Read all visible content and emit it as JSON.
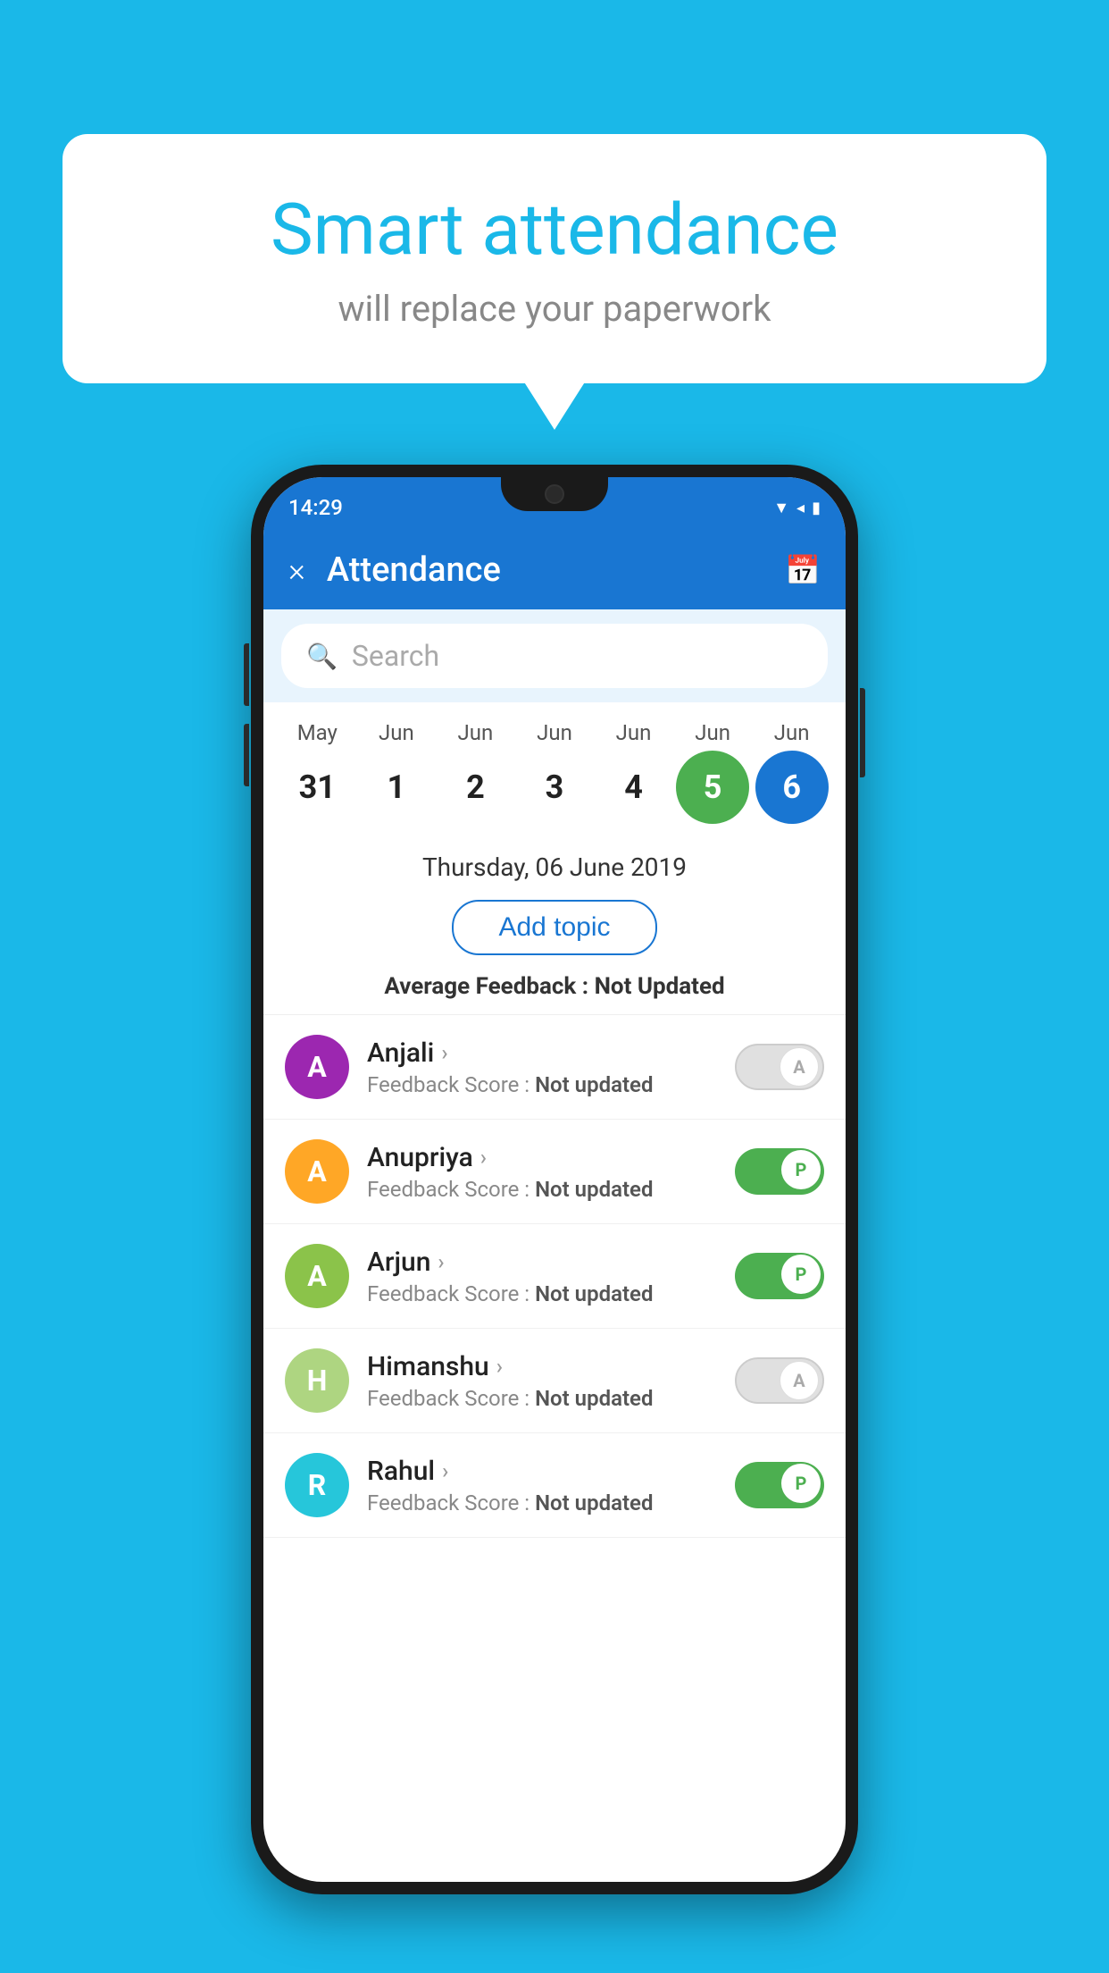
{
  "background_color": "#1ab8e8",
  "bubble": {
    "title": "Smart attendance",
    "subtitle": "will replace your paperwork"
  },
  "phone": {
    "status_bar": {
      "time": "14:29",
      "icons": [
        "wifi",
        "signal",
        "battery"
      ]
    },
    "app_bar": {
      "title": "Attendance",
      "close_label": "×",
      "calendar_icon": "📅"
    },
    "search": {
      "placeholder": "Search"
    },
    "calendar": {
      "months": [
        "May",
        "Jun",
        "Jun",
        "Jun",
        "Jun",
        "Jun",
        "Jun"
      ],
      "days": [
        31,
        1,
        2,
        3,
        4,
        5,
        6
      ],
      "today_index": 5,
      "selected_index": 6
    },
    "date_heading": "Thursday, 06 June 2019",
    "add_topic_label": "Add topic",
    "avg_feedback_label": "Average Feedback : ",
    "avg_feedback_value": "Not Updated",
    "students": [
      {
        "name": "Anjali",
        "avatar_letter": "A",
        "avatar_color": "#9c27b0",
        "feedback_label": "Feedback Score : ",
        "feedback_value": "Not updated",
        "status": "absent"
      },
      {
        "name": "Anupriya",
        "avatar_letter": "A",
        "avatar_color": "#ffa726",
        "feedback_label": "Feedback Score : ",
        "feedback_value": "Not updated",
        "status": "present"
      },
      {
        "name": "Arjun",
        "avatar_letter": "A",
        "avatar_color": "#8bc34a",
        "feedback_label": "Feedback Score : ",
        "feedback_value": "Not updated",
        "status": "present"
      },
      {
        "name": "Himanshu",
        "avatar_letter": "H",
        "avatar_color": "#aed581",
        "feedback_label": "Feedback Score : ",
        "feedback_value": "Not updated",
        "status": "absent"
      },
      {
        "name": "Rahul",
        "avatar_letter": "R",
        "avatar_color": "#26c6da",
        "feedback_label": "Feedback Score : ",
        "feedback_value": "Not updated",
        "status": "present"
      }
    ]
  }
}
